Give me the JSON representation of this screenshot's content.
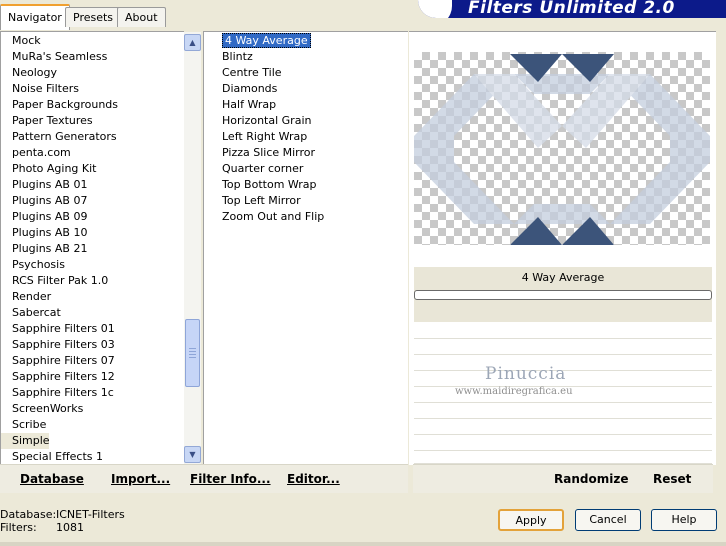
{
  "tabs": [
    {
      "label": "Navigator"
    },
    {
      "label": "Presets"
    },
    {
      "label": "About"
    }
  ],
  "banner": {
    "title": "Filters Unlimited 2.0"
  },
  "categories": [
    "Mock",
    "MuRa's Seamless",
    "Neology",
    "Noise Filters",
    "Paper Backgrounds",
    "Paper Textures",
    "Pattern Generators",
    "penta.com",
    "Photo Aging Kit",
    "Plugins AB 01",
    "Plugins AB 07",
    "Plugins AB 09",
    "Plugins AB 10",
    "Plugins AB 21",
    "Psychosis",
    "RCS Filter Pak 1.0",
    "Render",
    "Sabercat",
    "Sapphire Filters 01",
    "Sapphire Filters 03",
    "Sapphire Filters 07",
    "Sapphire Filters 12",
    "Sapphire Filters 1c",
    "ScreenWorks",
    "Scribe",
    "Simple",
    "Special Effects 1"
  ],
  "selected_category": "Simple",
  "filters": [
    "4 Way Average",
    "Blintz",
    "Centre Tile",
    "Diamonds",
    "Half Wrap",
    "Horizontal Grain",
    "Left Right Wrap",
    "Pizza Slice Mirror",
    "Quarter corner",
    "Top Bottom Wrap",
    "Top Left Mirror",
    "Zoom Out and Flip"
  ],
  "selected_filter": "4 Way Average",
  "preview": {
    "filter_name": "4 Way Average"
  },
  "watermark": {
    "name": "Pinuccia",
    "url": "www.maidiregrafica.eu"
  },
  "links": {
    "database": "Database",
    "import": "Import...",
    "filter_info": "Filter Info...",
    "editor": "Editor...",
    "randomize": "Randomize",
    "reset": "Reset"
  },
  "status": {
    "database_label": "Database:",
    "database_value": "ICNET-Filters",
    "filters_label": "Filters:",
    "filters_value": "1081"
  },
  "buttons": {
    "apply": "Apply",
    "cancel": "Cancel",
    "help": "Help"
  },
  "colors": {
    "banner": "#0c1a8a",
    "selection": "#316ac5",
    "preview_shape_dark": "#3c547a",
    "preview_shape_light": "#c4cede"
  }
}
